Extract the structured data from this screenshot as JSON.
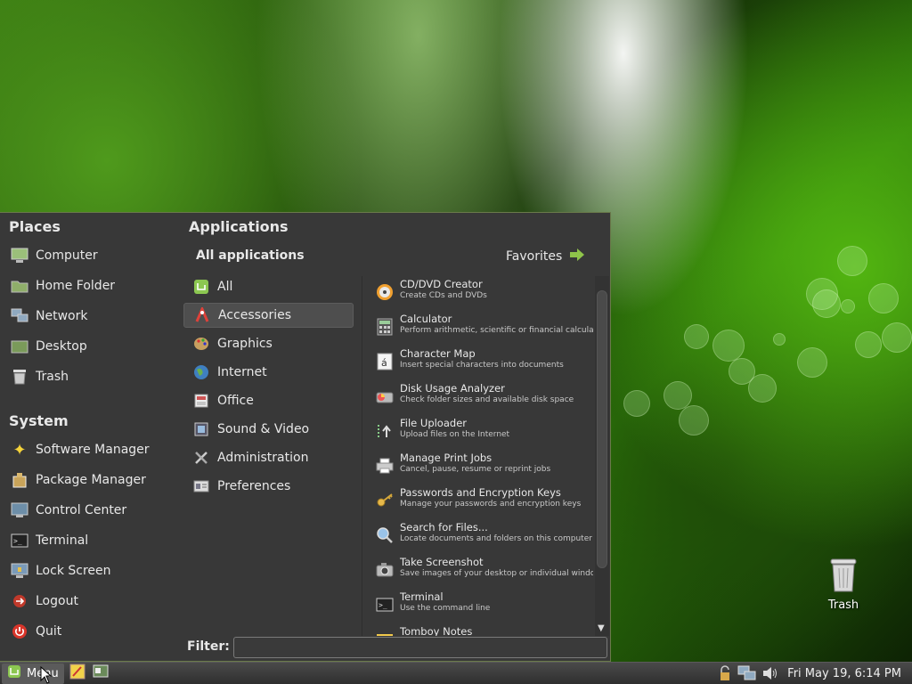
{
  "places": {
    "heading": "Places",
    "items": [
      "Computer",
      "Home Folder",
      "Network",
      "Desktop",
      "Trash"
    ]
  },
  "system": {
    "heading": "System",
    "items": [
      "Software Manager",
      "Package Manager",
      "Control Center",
      "Terminal",
      "Lock Screen",
      "Logout",
      "Quit"
    ]
  },
  "applications": {
    "heading": "Applications",
    "subheading": "All applications",
    "favorites_label": "Favorites",
    "categories": [
      "All",
      "Accessories",
      "Graphics",
      "Internet",
      "Office",
      "Sound & Video",
      "Administration",
      "Preferences"
    ],
    "selected_category": "Accessories",
    "apps": [
      {
        "name": "CD/DVD Creator",
        "desc": "Create CDs and DVDs"
      },
      {
        "name": "Calculator",
        "desc": "Perform arithmetic, scientific or financial calcula..."
      },
      {
        "name": "Character Map",
        "desc": "Insert special characters into documents"
      },
      {
        "name": "Disk Usage Analyzer",
        "desc": "Check folder sizes and available disk space"
      },
      {
        "name": "File Uploader",
        "desc": "Upload files on the Internet"
      },
      {
        "name": "Manage Print Jobs",
        "desc": "Cancel, pause, resume or reprint jobs"
      },
      {
        "name": "Passwords and Encryption Keys",
        "desc": "Manage your passwords and encryption keys"
      },
      {
        "name": "Search for Files...",
        "desc": "Locate documents and folders on this computer ..."
      },
      {
        "name": "Take Screenshot",
        "desc": "Save images of your desktop or individual windows"
      },
      {
        "name": "Terminal",
        "desc": "Use the command line"
      },
      {
        "name": "Tomboy Notes",
        "desc": ""
      }
    ]
  },
  "filter": {
    "label": "Filter:",
    "value": ""
  },
  "desktop": {
    "trash_label": "Trash"
  },
  "panel": {
    "menu_label": "Menu",
    "clock": "Fri May 19,  6:14 PM"
  },
  "colors": {
    "accent": "#7ab33e",
    "menu_bg": "#383838",
    "selected_bg": "#4e4e4e"
  }
}
